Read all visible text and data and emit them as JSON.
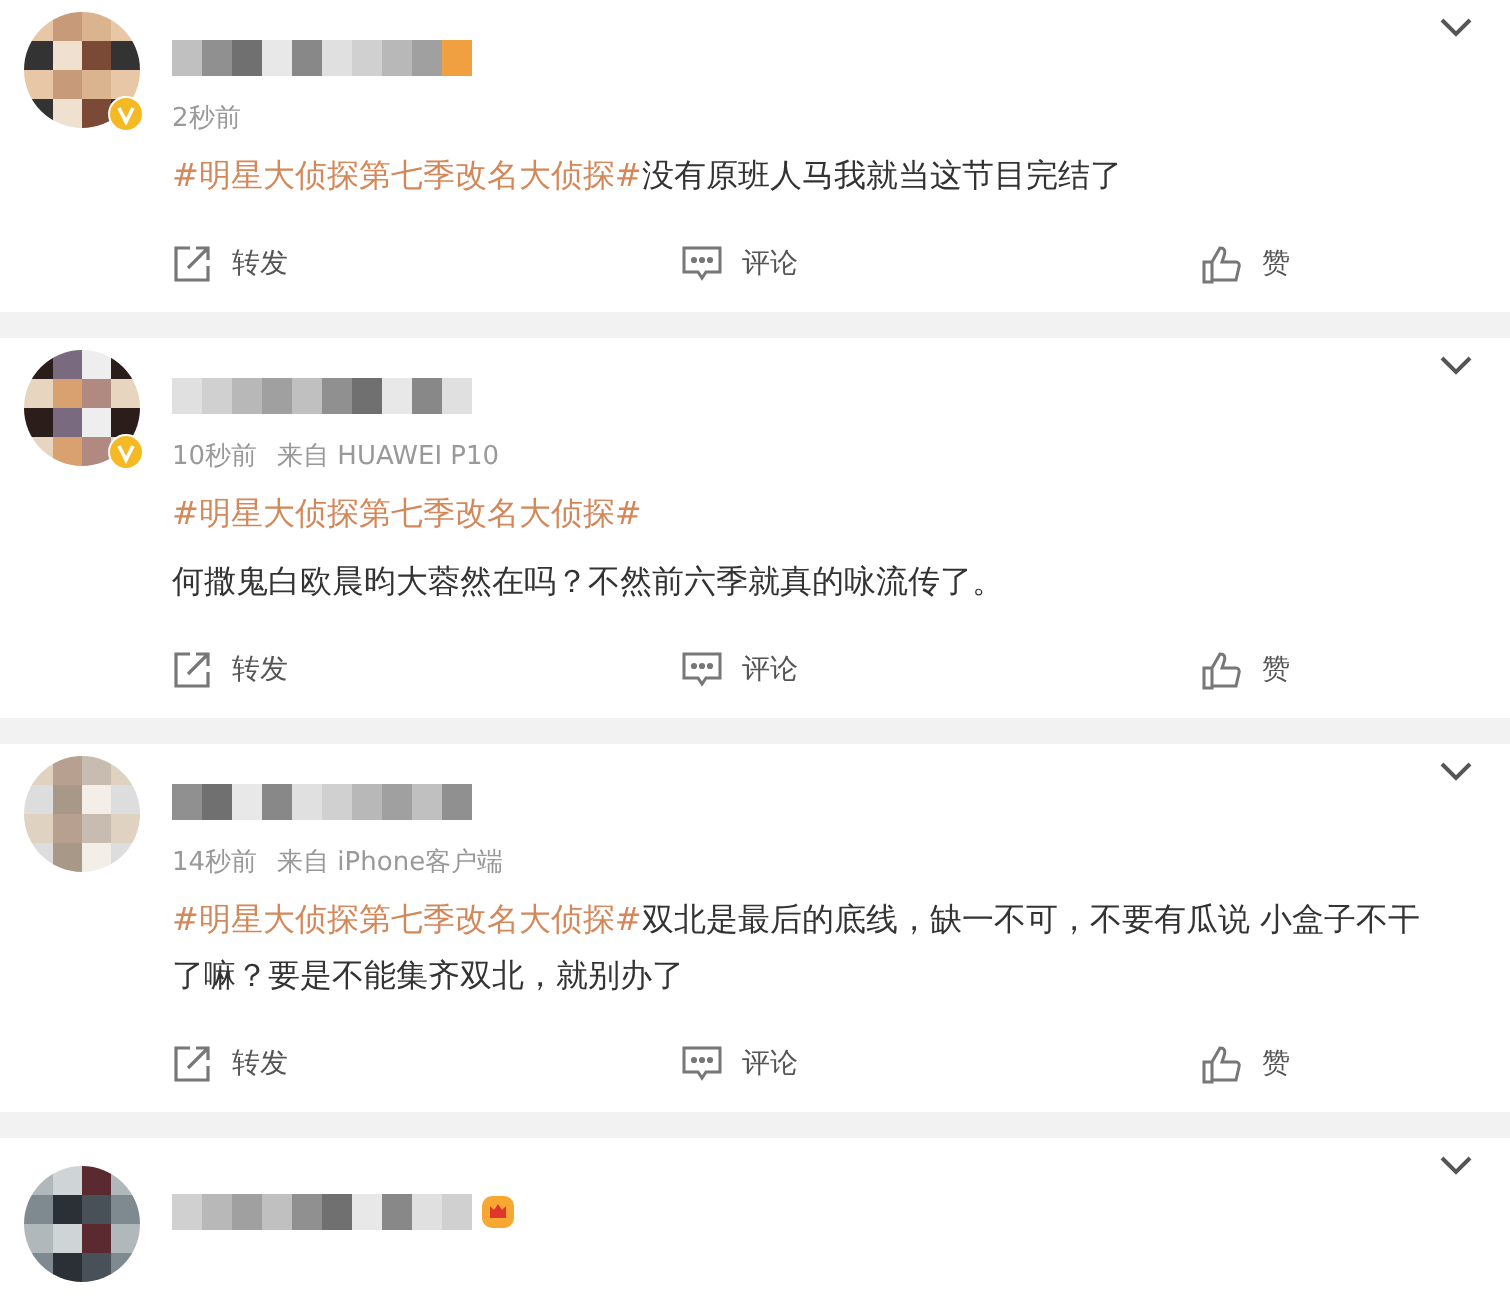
{
  "posts": [
    {
      "verified": true,
      "member_badge": false,
      "time": "2秒前",
      "paragraphs": [
        [
          {
            "kind": "hashtag",
            "text": "#明星大侦探第七季改名大侦探#"
          },
          {
            "kind": "text",
            "text": "没有原班人马我就当这节目完结了"
          }
        ]
      ],
      "actions": [
        "转发",
        "评论",
        "赞"
      ]
    },
    {
      "verified": true,
      "member_badge": false,
      "time": "10秒前",
      "source": "来自 HUAWEI P10",
      "paragraphs": [
        [
          {
            "kind": "hashtag",
            "text": "#明星大侦探第七季改名大侦探#"
          }
        ],
        [
          {
            "kind": "text",
            "text": "何撒鬼白欧晨昀大蓉然在吗？不然前六季就真的咏流传了。"
          }
        ]
      ],
      "actions": [
        "转发",
        "评论",
        "赞"
      ]
    },
    {
      "verified": false,
      "member_badge": false,
      "time": "14秒前",
      "source": "来自 iPhone客户端",
      "paragraphs": [
        [
          {
            "kind": "hashtag",
            "text": "#明星大侦探第七季改名大侦探#"
          },
          {
            "kind": "text",
            "text": "双北是最后的底线，缺一不可，不要有瓜说 小盒子不干了嘛？要是不能集齐双北，就别办了"
          }
        ]
      ],
      "actions": [
        "转发",
        "评论",
        "赞"
      ]
    },
    {
      "verified": false,
      "member_badge": true
    }
  ]
}
